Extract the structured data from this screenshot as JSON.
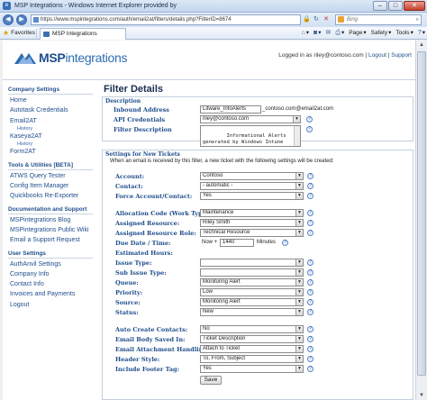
{
  "browser": {
    "window_title": "MSP Integrations - Windows Internet Explorer provided by",
    "url": "https://www.mspintegrations.com/auth/email2at/filters/details.php?FilterID=8674",
    "search_placeholder": "Bing",
    "favorites_label": "Favorites",
    "tab_label": "MSP Integrations",
    "tools": {
      "page": "Page",
      "safety": "Safety",
      "tools": "Tools"
    },
    "winbtn_min": "–",
    "winbtn_max": "□",
    "winbtn_close": "✕"
  },
  "header": {
    "brand_msp": "MSP",
    "brand_rest": "integrations",
    "logged_in_text": "Logged in as riley@contoso.com",
    "logout": "Logout",
    "support": "Support"
  },
  "sidebar": {
    "sections": [
      {
        "heading": "Company Settings",
        "items": [
          {
            "label": "Home"
          },
          {
            "label": "Autotask Credentials"
          },
          {
            "label": "Email2AT"
          },
          {
            "label": "Kaseya2AT"
          },
          {
            "label": "Form2AT"
          }
        ]
      },
      {
        "heading": "Tools & Utilities [BETA]",
        "items": [
          {
            "label": "ATWS Query Tester"
          },
          {
            "label": "Config Item Manager"
          },
          {
            "label": "Quickbooks Re-Exporter"
          }
        ]
      },
      {
        "heading": "Documentation and Support",
        "items": [
          {
            "label": "MSPintegrations Blog"
          },
          {
            "label": "MSPintegrations Public Wiki"
          },
          {
            "label": "Email a Support Request"
          }
        ]
      },
      {
        "heading": "User Settings",
        "items": [
          {
            "label": "AuthAnvil Settings"
          },
          {
            "label": "Company Info"
          },
          {
            "label": "Contact Info"
          },
          {
            "label": "Invoices and Payments"
          },
          {
            "label": "Logout"
          }
        ]
      }
    ],
    "history_label": "History"
  },
  "main": {
    "title": "Filter Details",
    "description_panel": {
      "title": "Description",
      "inbound_address_label": "Inbound Address",
      "inbound_address_value": "Litware_InfoAlerts",
      "inbound_address_suffix": "_contoso.com@email2at.com",
      "api_credentials_label": "API Credentials",
      "api_credentials_value": "riley@contoso.com",
      "filter_description_label": "Filter Description",
      "filter_description_value": "Informational Alerts\ngenerated by Windows Intune\nrelated to Litware."
    },
    "tickets_panel": {
      "title": "Settings for New Tickets",
      "intro": "When an email is received by this filter, a new ticket with the following settings will be created:",
      "fields": {
        "account": {
          "label": "Account:",
          "value": "Contoso"
        },
        "contact": {
          "label": "Contact:",
          "value": "- automatic -"
        },
        "force_account_contact": {
          "label": "Force Account/Contact:",
          "value": "Yes"
        },
        "allocation_code": {
          "label": "Allocation Code (Work Type):",
          "value": "Maintenance"
        },
        "assigned_resource": {
          "label": "Assigned Resource:",
          "value": "Riley Smith"
        },
        "assigned_resource_role": {
          "label": "Assigned Resource Role:",
          "value": "Technical Resource"
        },
        "due_date": {
          "label": "Due Date / Time:",
          "prefix": "Now +",
          "value": "1440",
          "suffix": "Minutes"
        },
        "estimated_hours": {
          "label": "Estimated Hours:",
          "value": ""
        },
        "issue_type": {
          "label": "Issue Type:",
          "value": ""
        },
        "sub_issue_type": {
          "label": "Sub Issue Type:",
          "value": ""
        },
        "queue": {
          "label": "Queue:",
          "value": "Monitoring Alert"
        },
        "priority": {
          "label": "Priority:",
          "value": "Low"
        },
        "source": {
          "label": "Source:",
          "value": "Monitoring Alert"
        },
        "status": {
          "label": "Status:",
          "value": "New"
        },
        "auto_create_contacts": {
          "label": "Auto Create Contacts:",
          "value": "No"
        },
        "email_body_saved_in": {
          "label": "Email Body Saved In:",
          "value": "Ticket Description"
        },
        "email_attachment_handling": {
          "label": "Email Attachment Handling:",
          "value": "Attach to Ticket"
        },
        "header_style": {
          "label": "Header Style:",
          "value": "To, From, Subject"
        },
        "include_footer_tag": {
          "label": "Include Footer Tag:",
          "value": "Yes"
        }
      },
      "save_label": "Save"
    },
    "help_glyph": "?",
    "dropdown_glyph": "▼"
  },
  "colors": {
    "link": "#1f4e8c",
    "accent": "#2e6db3"
  },
  "icons": [
    "back-icon",
    "forward-icon",
    "page-icon",
    "refresh-icon",
    "stop-icon",
    "search-icon",
    "favorites-star-icon",
    "home-icon",
    "rss-icon",
    "print-icon",
    "help-icon",
    "dropdown-arrow-icon",
    "logo-icon"
  ]
}
